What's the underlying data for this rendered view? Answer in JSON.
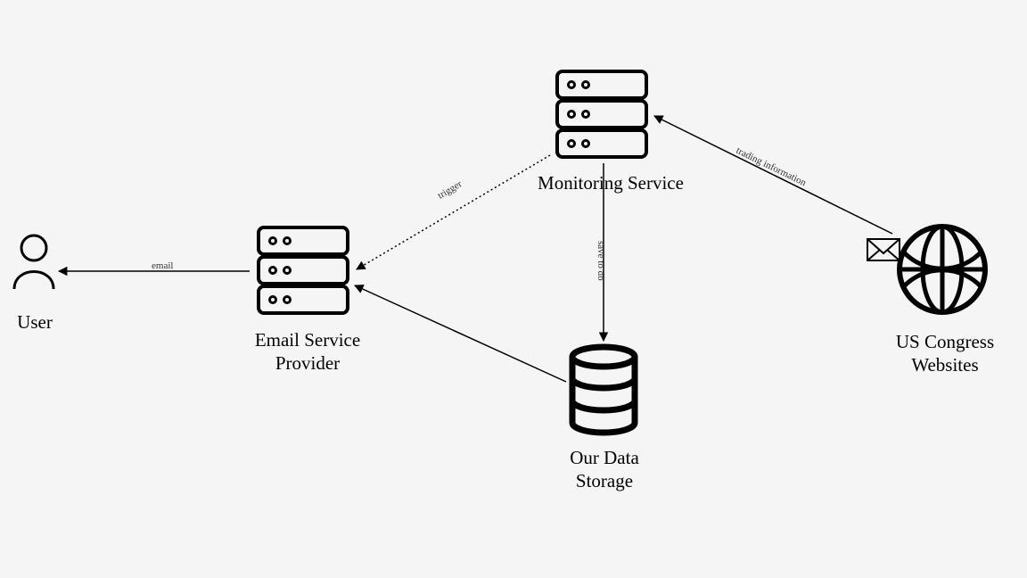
{
  "nodes": {
    "user": {
      "label": "User"
    },
    "email_service": {
      "label": "Email Service\nProvider"
    },
    "monitoring": {
      "label": "Monitoring Service"
    },
    "storage": {
      "label": "Our Data\nStorage"
    },
    "congress": {
      "label": "US Congress\nWebsites"
    }
  },
  "edges": {
    "email": {
      "label": "email"
    },
    "trigger": {
      "label": "trigger"
    },
    "save": {
      "label": "save to db"
    },
    "trading": {
      "label": "trading information"
    }
  }
}
